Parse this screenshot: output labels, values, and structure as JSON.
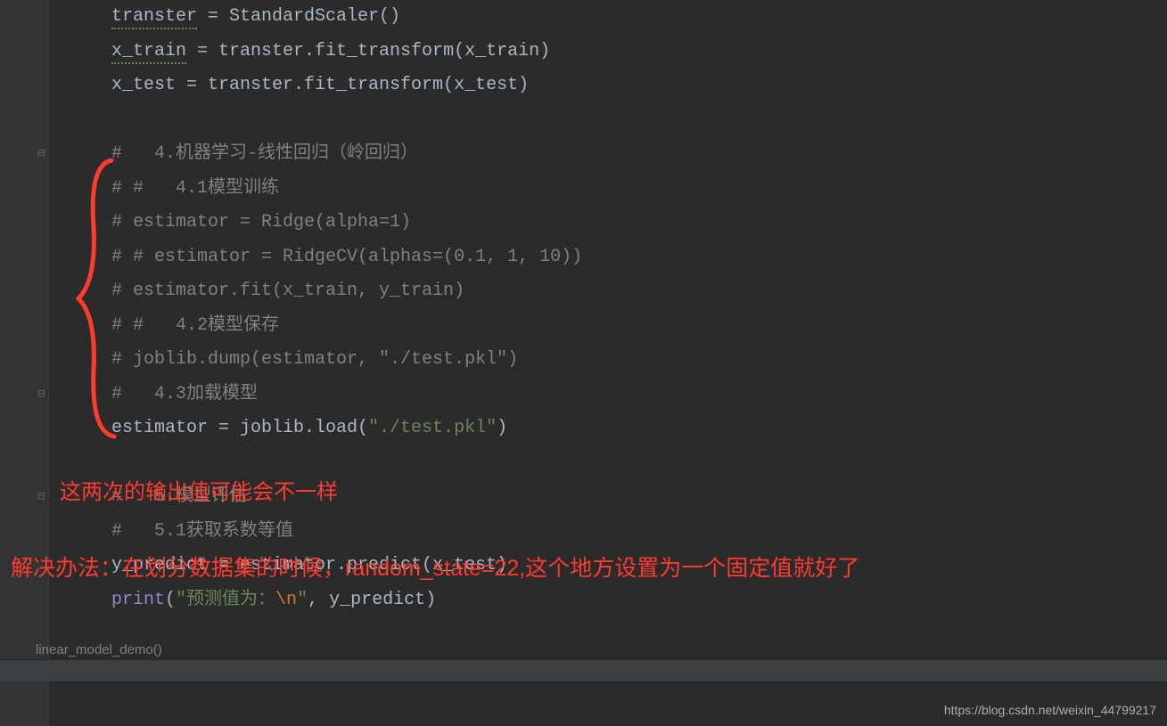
{
  "code": {
    "lines": [
      {
        "segments": [
          {
            "t": "transter",
            "c": "squiggle"
          },
          {
            "t": " = StandardScaler()",
            "c": "code-default"
          }
        ]
      },
      {
        "segments": [
          {
            "t": "x_train",
            "c": "squiggle"
          },
          {
            "t": " = transter.fit_transform(x_train)",
            "c": "code-default"
          }
        ]
      },
      {
        "segments": [
          {
            "t": "x_test = transter.fit_transform(x_test)",
            "c": "code-default"
          }
        ]
      },
      {
        "segments": [
          {
            "t": "",
            "c": "code-default"
          }
        ]
      },
      {
        "segments": [
          {
            "t": "#   4.机器学习-线性回归（岭回归）",
            "c": "code-comment"
          }
        ],
        "fold": "minus"
      },
      {
        "segments": [
          {
            "t": "# #   4.1模型训练",
            "c": "code-comment"
          }
        ]
      },
      {
        "segments": [
          {
            "t": "# estimator = Ridge(alpha=1)",
            "c": "code-comment"
          }
        ]
      },
      {
        "segments": [
          {
            "t": "# # estimator = RidgeCV(alphas=(0.1, 1, 10))",
            "c": "code-comment"
          }
        ]
      },
      {
        "segments": [
          {
            "t": "# estimator.fit(x_train, y_train)",
            "c": "code-comment"
          }
        ]
      },
      {
        "segments": [
          {
            "t": "# #   4.2模型保存",
            "c": "code-comment"
          }
        ]
      },
      {
        "segments": [
          {
            "t": "# joblib.dump(estimator, \"./test.pkl\")",
            "c": "code-comment"
          }
        ]
      },
      {
        "segments": [
          {
            "t": "#   4.3加载模型",
            "c": "code-comment"
          }
        ],
        "fold": "minus2"
      },
      {
        "segments": [
          {
            "t": "estimator = joblib.load(",
            "c": "code-default"
          },
          {
            "t": "\"./test.pkl\"",
            "c": "code-string"
          },
          {
            "t": ")",
            "c": "code-default"
          }
        ]
      },
      {
        "segments": [
          {
            "t": "",
            "c": "code-default"
          }
        ]
      },
      {
        "segments": [
          {
            "t": "#   5.模型评估",
            "c": "code-comment"
          }
        ],
        "fold": "minus"
      },
      {
        "segments": [
          {
            "t": "#   5.1获取系数等值",
            "c": "code-comment"
          }
        ]
      },
      {
        "segments": [
          {
            "t": "y_predict = estimator.predict(x_test)",
            "c": "code-default"
          }
        ]
      },
      {
        "segments": [
          {
            "t": "print",
            "c": "code-builtin"
          },
          {
            "t": "(",
            "c": "code-default"
          },
          {
            "t": "\"预测值为：",
            "c": "code-string"
          },
          {
            "t": "\\n",
            "c": "code-escape"
          },
          {
            "t": "\"",
            "c": "code-string"
          },
          {
            "t": ", ",
            "c": "code-default"
          },
          {
            "t": "y_predict)",
            "c": "code-default"
          }
        ]
      }
    ]
  },
  "annotations": {
    "note1": "这两次的输出值可能会不一样",
    "note2": "解决办法：在划分数据集的时候，random_state=22,这个地方设置为一个固定值就好了"
  },
  "breadcrumb": "linear_model_demo()",
  "watermark": "https://blog.csdn.net/weixin_44799217"
}
